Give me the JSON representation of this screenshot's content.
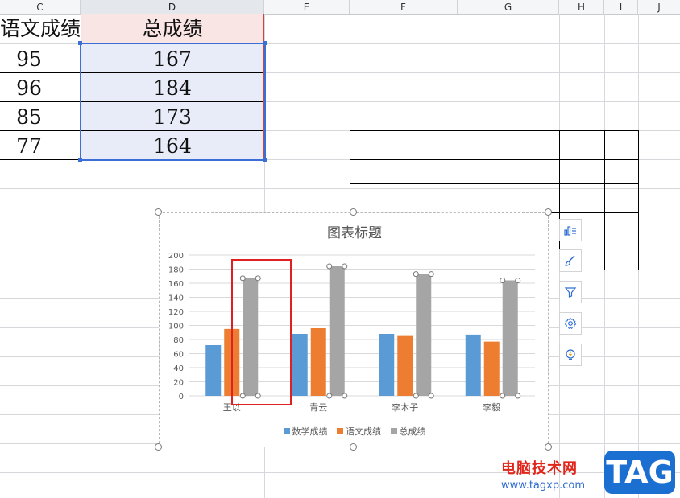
{
  "columns": [
    "C",
    "D",
    "E",
    "F",
    "G",
    "H",
    "I",
    "J"
  ],
  "table": {
    "header_partial": "语文成绩",
    "header_total": "总成绩",
    "rows": [
      {
        "chinese": "95",
        "total": "167"
      },
      {
        "chinese": "96",
        "total": "184"
      },
      {
        "chinese": "85",
        "total": "173"
      },
      {
        "chinese": "77",
        "total": "164"
      }
    ]
  },
  "chart": {
    "title": "图表标题"
  },
  "chart_data": {
    "type": "bar",
    "title": "图表标题",
    "categories": [
      "王以",
      "青云",
      "李木子",
      "李毅"
    ],
    "series": [
      {
        "name": "数学成绩",
        "values": [
          72,
          88,
          88,
          87
        ],
        "color": "#5b9bd5"
      },
      {
        "name": "语文成绩",
        "values": [
          95,
          96,
          85,
          77
        ],
        "color": "#ed7d31"
      },
      {
        "name": "总成绩",
        "values": [
          167,
          184,
          173,
          164
        ],
        "color": "#a5a5a5"
      }
    ],
    "ylim": [
      0,
      200
    ],
    "yticks": [
      "0",
      "20",
      "40",
      "60",
      "80",
      "100",
      "120",
      "140",
      "160",
      "180",
      "200"
    ],
    "grid": true,
    "legend": "bottom",
    "selected_series": "总成绩"
  },
  "tools": [
    "chart-elements-icon",
    "chart-style-icon",
    "chart-filter-icon",
    "chart-settings-icon",
    "chart-idea-icon"
  ],
  "watermark": {
    "text": "电脑技术网",
    "url": "www.tagxp.com",
    "badge": "TAG"
  }
}
